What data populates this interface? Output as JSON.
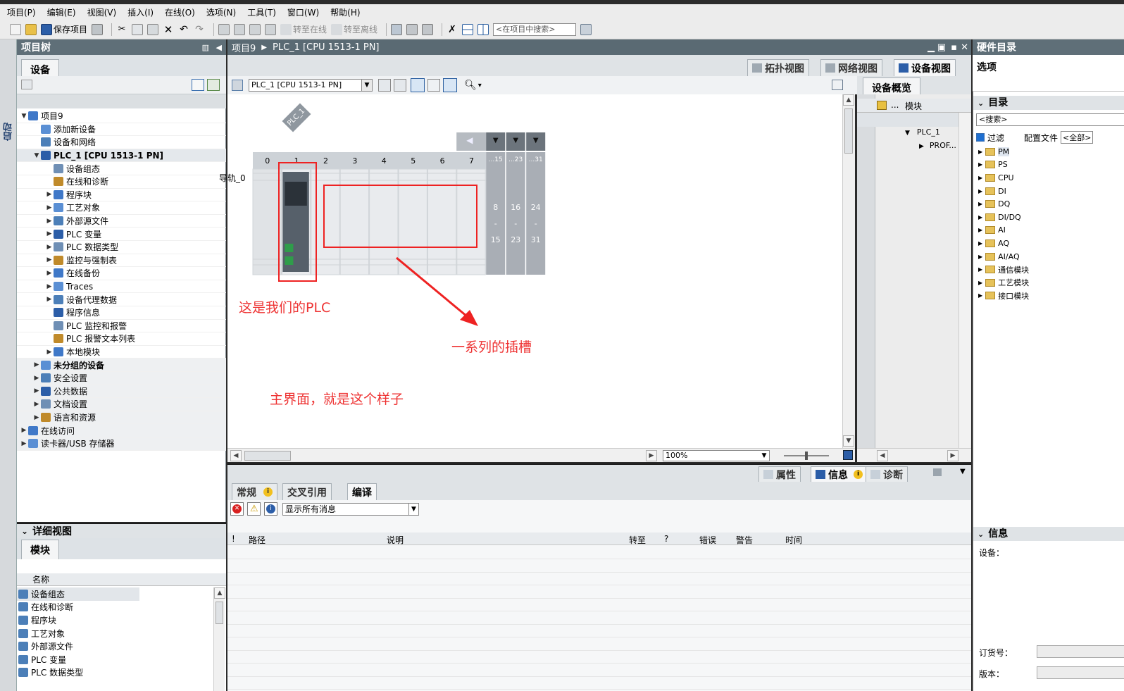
{
  "menu": [
    "项目(P)",
    "编辑(E)",
    "视图(V)",
    "插入(I)",
    "在线(O)",
    "选项(N)",
    "工具(T)",
    "窗口(W)",
    "帮助(H)"
  ],
  "toolbar": {
    "save_label": "保存项目",
    "go_online_label": "转至在线",
    "go_offline_label": "转至离线",
    "search_placeholder": "<在项目中搜索>"
  },
  "start_label": "启动",
  "project_tree": {
    "title": "项目树",
    "tab": "设备",
    "items": [
      {
        "label": "项目9",
        "level": 0,
        "expand": "▼"
      },
      {
        "label": "添加新设备",
        "level": 1,
        "expand": ""
      },
      {
        "label": "设备和网络",
        "level": 1,
        "expand": ""
      },
      {
        "label": "PLC_1 [CPU 1513-1 PN]",
        "level": 1,
        "expand": "▼"
      },
      {
        "label": "设备组态",
        "level": 2,
        "expand": ""
      },
      {
        "label": "在线和诊断",
        "level": 2,
        "expand": ""
      },
      {
        "label": "程序块",
        "level": 2,
        "expand": "▶"
      },
      {
        "label": "工艺对象",
        "level": 2,
        "expand": "▶"
      },
      {
        "label": "外部源文件",
        "level": 2,
        "expand": "▶"
      },
      {
        "label": "PLC 变量",
        "level": 2,
        "expand": "▶"
      },
      {
        "label": "PLC 数据类型",
        "level": 2,
        "expand": "▶"
      },
      {
        "label": "监控与强制表",
        "level": 2,
        "expand": "▶"
      },
      {
        "label": "在线备份",
        "level": 2,
        "expand": "▶"
      },
      {
        "label": "Traces",
        "level": 2,
        "expand": "▶"
      },
      {
        "label": "设备代理数据",
        "level": 2,
        "expand": "▶"
      },
      {
        "label": "程序信息",
        "level": 2,
        "expand": ""
      },
      {
        "label": "PLC 监控和报警",
        "level": 2,
        "expand": ""
      },
      {
        "label": "PLC 报警文本列表",
        "level": 2,
        "expand": ""
      },
      {
        "label": "本地模块",
        "level": 2,
        "expand": "▶"
      },
      {
        "label": "未分组的设备",
        "level": 1,
        "expand": "▶"
      },
      {
        "label": "安全设置",
        "level": 1,
        "expand": "▶"
      },
      {
        "label": "公共数据",
        "level": 1,
        "expand": "▶"
      },
      {
        "label": "文档设置",
        "level": 1,
        "expand": "▶"
      },
      {
        "label": "语言和资源",
        "level": 1,
        "expand": "▶"
      },
      {
        "label": "在线访问",
        "level": 0,
        "expand": "▶"
      },
      {
        "label": "读卡器/USB 存储器",
        "level": 0,
        "expand": "▶"
      }
    ]
  },
  "detail_view": {
    "title": "详细视图",
    "tab": "模块",
    "column": "名称",
    "items": [
      "设备组态",
      "在线和诊断",
      "程序块",
      "工艺对象",
      "外部源文件",
      "PLC 变量",
      "PLC 数据类型"
    ]
  },
  "editor": {
    "breadcrumb_project": "项目9",
    "breadcrumb_device": "PLC_1 [CPU 1513-1 PN]",
    "tabs": [
      "拓扑视图",
      "网络视图",
      "设备视图"
    ],
    "device_select": "PLC_1 [CPU 1513-1 PN]",
    "plc_tag": "PLC_1",
    "rail_label": "导轨_0",
    "slots": [
      "0",
      "1",
      "2",
      "3",
      "4",
      "5",
      "6",
      "7"
    ],
    "slot_groups": [
      "...15",
      "...23",
      "...31"
    ],
    "slot_group_ranges": [
      {
        "from": "8",
        "dash": "-",
        "to": "15"
      },
      {
        "from": "16",
        "dash": "-",
        "to": "23"
      },
      {
        "from": "24",
        "dash": "-",
        "to": "31"
      }
    ],
    "zoom": "100%"
  },
  "annotations": {
    "plc_note": "这是我们的PLC",
    "slots_note": "一系列的插槽",
    "main_note": "主界面，就是这个样子"
  },
  "device_overview": {
    "tab": "设备概览",
    "col_module": "模块",
    "col_dots": "...",
    "rows": [
      "PLC_1",
      "PROF..."
    ]
  },
  "inspector": {
    "tabs": [
      "属性",
      "信息",
      "诊断"
    ],
    "subtabs": [
      "常规",
      "交叉引用",
      "编译"
    ],
    "filter": "显示所有消息",
    "columns": [
      "!",
      "路径",
      "说明",
      "转至",
      "?",
      "错误",
      "警告",
      "时间"
    ]
  },
  "hardware_catalog": {
    "title": "硬件目录",
    "options": "选项",
    "catalog": "目录",
    "search_placeholder": "<搜索>",
    "filter_label": "过滤",
    "profile_label": "配置文件",
    "profile_value": "<全部>",
    "items": [
      "PM",
      "PS",
      "CPU",
      "DI",
      "DQ",
      "DI/DQ",
      "AI",
      "AQ",
      "AI/AQ",
      "通信模块",
      "工艺模块",
      "接口模块"
    ],
    "info_title": "信息",
    "device_label": "设备：",
    "order_label": "订货号：",
    "version_label": "版本："
  },
  "colors": {
    "panel_header": "#5f6f78",
    "annotation_red": "#ee2222",
    "rack_gray": "#a9aeb5",
    "cpu_green": "#2f9d4a"
  }
}
